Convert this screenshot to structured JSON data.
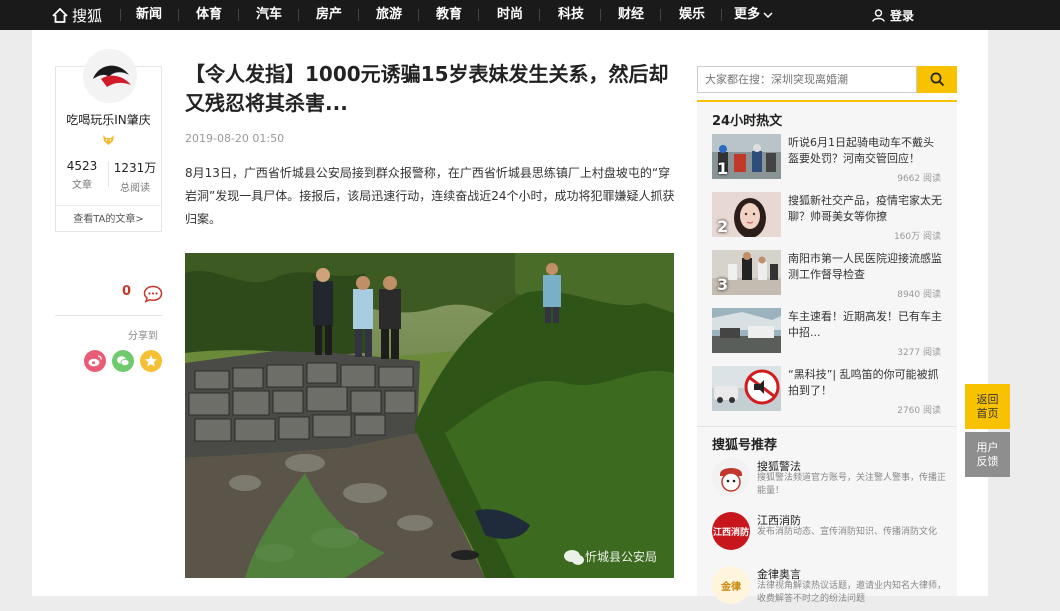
{
  "nav": {
    "logo_text": "搜狐",
    "items": [
      "新闻",
      "体育",
      "汽车",
      "房产",
      "旅游",
      "教育",
      "时尚",
      "科技",
      "财经",
      "娱乐"
    ],
    "more": "更多",
    "login": "登录"
  },
  "author": {
    "name": "吃喝玩乐IN肇庆",
    "articles_count": "4523",
    "articles_label": "文章",
    "reads_count": "1231万",
    "reads_label": "总阅读",
    "link_label": "查看TA的文章>"
  },
  "side": {
    "comment_count": "0",
    "share_label": "分享到"
  },
  "article": {
    "title": "【令人发指】1000元诱骗15岁表妹发生关系，然后却又残忍将其杀害...",
    "date": "2019-08-20 01:50",
    "paragraph": "8月13日，广西省忻城县公安局接到群众报警称，在广西省忻城县思练镇厂上村盘坡屯的“穿岩洞”发现一具尸体。接报后，该局迅速行动，连续奋战近24个小时，成功将犯罪嫌疑人抓获归案。",
    "image_watermark": "忻城县公安局"
  },
  "search": {
    "placeholder": "大家都在搜：深圳突现离婚潮"
  },
  "hot": {
    "title": "24小时热文",
    "items": [
      {
        "rank": "1",
        "text": "听说6月1日起骑电动车不戴头盔要处罚？河南交管回应！",
        "reads": "9662 阅读"
      },
      {
        "rank": "2",
        "text": "搜狐新社交产品，疫情宅家太无聊？帅哥美女等你撩",
        "reads": "160万 阅读"
      },
      {
        "rank": "3",
        "text": "南阳市第一人民医院迎接流感监测工作督导检查",
        "reads": "8940 阅读"
      },
      {
        "rank": "",
        "text": "车主速看！近期高发！已有车主中招...",
        "reads": "3277 阅读"
      },
      {
        "rank": "",
        "text": "“黑科技”| 乱鸣笛的你可能被抓拍到了！",
        "reads": "2760 阅读"
      }
    ]
  },
  "recommend": {
    "title": "搜狐号推荐",
    "items": [
      {
        "name": "搜狐警法",
        "desc": "搜狐警法频道官方账号，关注警人警事，传播正能量！"
      },
      {
        "name": "江西消防",
        "desc": "发布消防动态、宣传消防知识、传播消防文化"
      },
      {
        "name": "金律奥言",
        "desc": "法律视角解读热议话题，邀请业内知名大律师，收费解答不时之的纷法问题"
      }
    ]
  },
  "float": {
    "top": "返回首页",
    "feedback": "用户反馈"
  },
  "colors": {
    "accent": "#f8c200",
    "nav_bg": "#1a1a1a",
    "feedback_bg": "#8e8e8e"
  }
}
